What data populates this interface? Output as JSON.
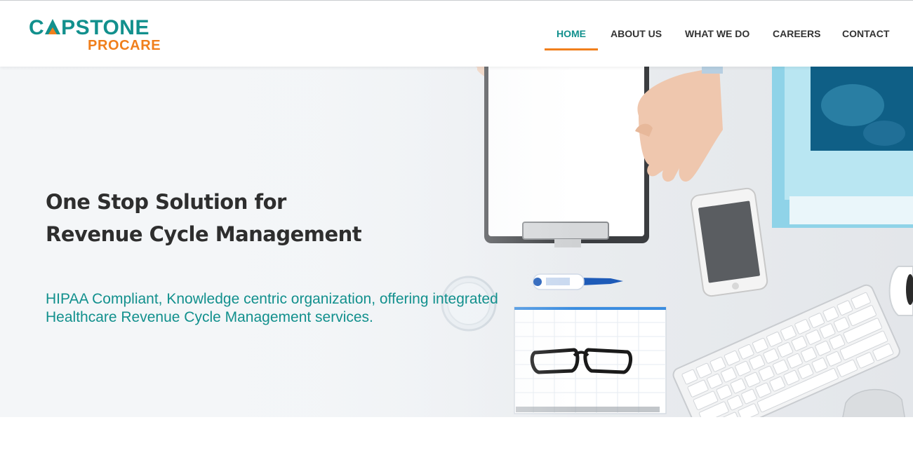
{
  "brand": {
    "name_top": "CAPSTONE",
    "name_bottom": "PROCARE",
    "teal": "#12908d",
    "orange": "#f07f1c"
  },
  "nav": {
    "items": [
      {
        "label": "HOME",
        "active": true
      },
      {
        "label": "ABOUT US",
        "active": false
      },
      {
        "label": "WHAT WE DO",
        "active": false
      },
      {
        "label": "CAREERS",
        "active": false
      },
      {
        "label": "CONTACT",
        "active": false
      }
    ]
  },
  "hero": {
    "title_line1": "One Stop Solution for",
    "title_line2": "Revenue Cycle Management",
    "subtitle_line1": "HIPAA Compliant, Knowledge centric organization, offering integrated",
    "subtitle_line2": "Healthcare Revenue Cycle Management services."
  }
}
